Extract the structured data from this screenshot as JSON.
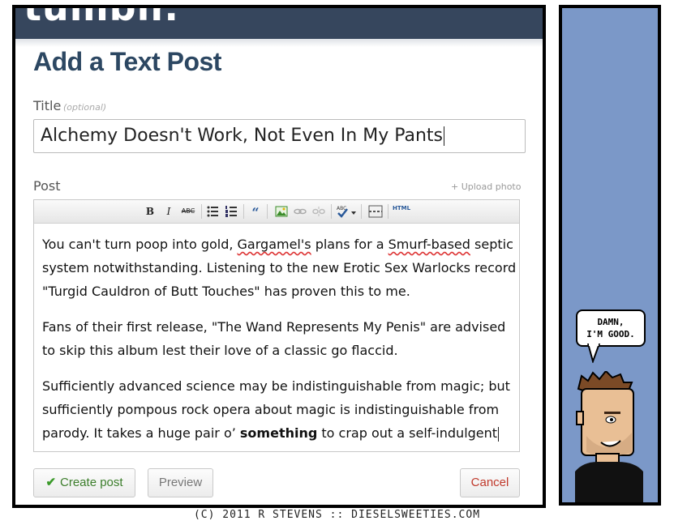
{
  "brand": {
    "logo_text": "tumblr."
  },
  "form": {
    "page_title": "Add a Text Post",
    "title_label": "Title",
    "title_hint": "(optional)",
    "title_value": "Alchemy Doesn't Work, Not Even In My Pants",
    "post_label": "Post",
    "upload_link": "+ Upload photo"
  },
  "toolbar": {
    "bold": "B",
    "italic": "I",
    "strike": "ABC",
    "html": "HTML"
  },
  "editor": {
    "p1_a": "You can't turn poop into gold, ",
    "p1_gargamel": "Gargamel's",
    "p1_b": " plans for a ",
    "p1_smurf": "Smurf-based",
    "p1_c": " septic system notwithstanding. Listening to the new Erotic Sex Warlocks record \"Turgid Cauldron of Butt Touches\" has proven this to me.",
    "p2": "Fans of their first release, \"The Wand Represents My Penis\" are advised to skip this album lest their love of a classic go flaccid.",
    "p3_a": "Sufficiently advanced science may be indistinguishable from magic; but sufficiently pompous rock opera about magic is indistinguishable from parody. It takes a huge pair o’ ",
    "p3_bold": "something",
    "p3_b": " to crap out a self-indulgent"
  },
  "actions": {
    "create": "Create post",
    "preview": "Preview",
    "cancel": "Cancel"
  },
  "comic": {
    "speech_line1": "DAMN,",
    "speech_line2": "I'M GOOD.",
    "copyright": "(C) 2011  R STEVENS :: DIESELSWEETIES.COM"
  },
  "colors": {
    "brand_bar": "#36465d",
    "title_text": "#2c4762",
    "create_green": "#3b7d2a",
    "cancel_red": "#c0392b",
    "comic_bg": "#7b98c8"
  }
}
